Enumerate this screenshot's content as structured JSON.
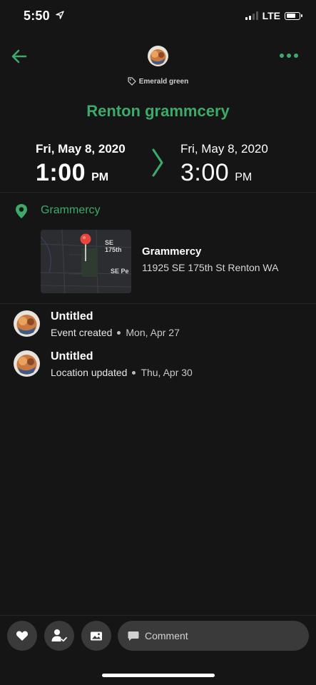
{
  "status_bar": {
    "time": "5:50",
    "network": "LTE",
    "battery_level": 0.75
  },
  "header": {
    "tag": "Emerald green",
    "title": "Renton grammcery"
  },
  "time_range": {
    "start_date": "Fri, May 8, 2020",
    "start_time": "1:00",
    "start_ampm": "PM",
    "end_date": "Fri, May 8, 2020",
    "end_time": "3:00",
    "end_ampm": "PM"
  },
  "location": {
    "name": "Grammercy",
    "card_title": "Grammercy",
    "address": "11925 SE 175th St Renton WA",
    "map_labels": [
      "SE 175th",
      "SE Pe"
    ]
  },
  "activity": [
    {
      "title": "Untitled",
      "action": "Event created",
      "date": "Mon, Apr 27"
    },
    {
      "title": "Untitled",
      "action": "Location updated",
      "date": "Thu, Apr 30"
    }
  ],
  "bottom_bar": {
    "comment_placeholder": "Comment"
  },
  "colors": {
    "accent": "#3daa6a",
    "background": "#151515",
    "button": "#3a3a3a"
  }
}
